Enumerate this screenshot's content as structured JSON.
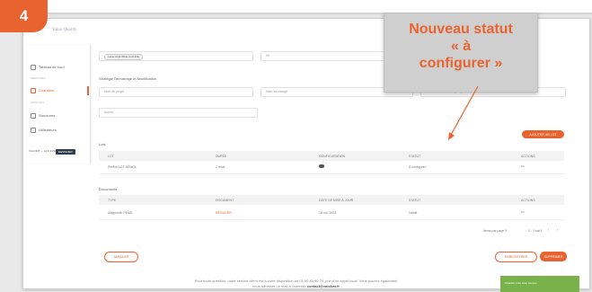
{
  "step_number": "4",
  "logo_text": "Value Quality",
  "callout": {
    "line1": "Nouveau statut",
    "line2": "« à",
    "line3": "configurer »"
  },
  "sidebar": {
    "items": [
      {
        "label": "Tableau de bord"
      },
      {
        "section": "SERVICES"
      },
      {
        "label": "Chantiers"
      },
      {
        "section": "GESTION"
      },
      {
        "label": "Structures"
      },
      {
        "label": "Utilisateurs"
      }
    ],
    "footer_label": "VALORIT — ALK EVERS",
    "footer_badge": "DESIGNER"
  },
  "form": {
    "chip_label": "Label HQE Biblio Ind'HOE",
    "field_value_2": "90",
    "section_title": "Stratégie Démarrage et Modification",
    "placeholder_1": "Nom du projet",
    "placeholder_2": "Nom du chargé",
    "placeholder_3": "Adresse du chantier (ville)",
    "select_value": "Aucun"
  },
  "add_lot_button": "AJOUTER UN LOT",
  "lots": {
    "title": "Lots",
    "headers": [
      "LOT",
      "DURÉE",
      "CONFIGURATION",
      "STATUT",
      "ACTIONS"
    ],
    "rows": [
      [
        "Préfixe LOT DÉMOL",
        "2 mois",
        "",
        "À configurer",
        "•••"
      ]
    ]
  },
  "documents": {
    "title": "Documents",
    "headers": [
      "TYPE",
      "DOCUMENT",
      "DATE DE MISE À JOUR",
      "STATUT",
      "ACTIONS"
    ],
    "rows": [
      [
        "Diagnostic PEMD",
        "RÉGULIER",
        "18 oct. 2023",
        "Validé",
        "•••"
      ]
    ]
  },
  "pagination": {
    "per_page": "Items par page  5",
    "range": "1 - 1 sur 1"
  },
  "buttons": {
    "cancel": "ANNULER",
    "save": "ENREGISTRER",
    "submit": "SUPPRIMER"
  },
  "footer": {
    "line1": "Pour toute question, notre service client est à votre disposition au 01 80 83 60 79, prix d'un appel local. Vous pouvez également",
    "line2_prefix": "nous adresser un mail à l'adresse",
    "line2_email": "contact@valobat.fr"
  },
  "toast": "Chantier créé avec succès",
  "colors": {
    "accent": "#e8632f",
    "toast": "#79b24a"
  }
}
